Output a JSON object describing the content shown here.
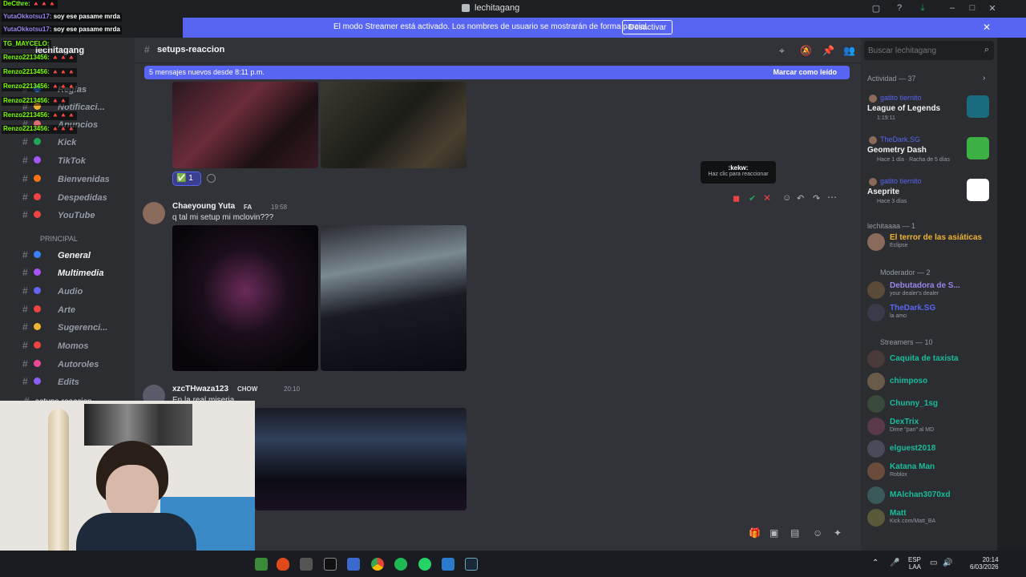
{
  "window": {
    "title": "lechitagang"
  },
  "banner": {
    "message": "El modo Streamer está activado. Los nombres de usuario se mostrarán de forma parcial.",
    "button": "Desactivar"
  },
  "stream_chat": [
    {
      "user": "DeCthre:",
      "text": "🔺🔺🔺"
    },
    {
      "user": "YutaOkkotsu17:",
      "text": "soy ese pasame mrda"
    },
    {
      "user": "YutaOkkotsu17:",
      "text": "soy ese pasame mrda"
    },
    {
      "user": "TG_MAYCELO:",
      "text": ""
    },
    {
      "user": "Renzo2213456:",
      "text": "🔺🔺🔺"
    },
    {
      "user": "Renzo2213456:",
      "text": "🔺🔺🔺"
    },
    {
      "user": "Renzo2213456:",
      "text": "🔺🔺🔺"
    },
    {
      "user": "Renzo2213456:",
      "text": "🔺🔺"
    },
    {
      "user": "Renzo2213456:",
      "text": "🔺🔺🔺"
    },
    {
      "user": "Renzo2213456:",
      "text": "🔺🔺🔺"
    }
  ],
  "sidebar": {
    "server_name": "lechitagang",
    "channels": [
      {
        "label": "Reglas"
      },
      {
        "label": "Notificaci..."
      },
      {
        "label": "Anuncios"
      },
      {
        "label": "Kick"
      },
      {
        "label": "TikTok"
      },
      {
        "label": "Bienvenidas"
      },
      {
        "label": "Despedidas"
      },
      {
        "label": "YouTube"
      }
    ],
    "category": "PRINCIPAL",
    "principal_channels": [
      {
        "label": "General"
      },
      {
        "label": "Multimedia"
      },
      {
        "label": "Audio"
      },
      {
        "label": "Arte"
      },
      {
        "label": "Sugerenci..."
      },
      {
        "label": "Momos"
      },
      {
        "label": "Autoroles"
      },
      {
        "label": "Edits"
      }
    ],
    "current_channel": "setups-reaccion"
  },
  "header": {
    "channel": "setups-reaccion"
  },
  "new_messages": {
    "label": "5 mensajes nuevos desde 8:11 p.m.",
    "action": "Marcar como leído"
  },
  "messages": [
    {
      "reaction_count": "1"
    },
    {
      "author": "Chaeyoung Yuta",
      "tag": "FA",
      "time": "19:58",
      "text": "q tal mi setup mi mclovin???"
    },
    {
      "author": "xzcTHwaza123",
      "tag": "CHOW",
      "time": "20:10",
      "text": "En la real miseria"
    }
  ],
  "tooltip": {
    "name": ":kekw:",
    "hint": "Haz clic para reaccionar"
  },
  "members": {
    "search_placeholder": "Buscar lechitagang",
    "activity_header": "Actividad — 37",
    "activities": [
      {
        "user": "gatito tiernito",
        "title": "League of Legends",
        "sub": "1:19:11",
        "color": "#1a6b7e"
      },
      {
        "user": "TheDark.SG",
        "title": "Geometry Dash",
        "sub": "Hace 1 día · Racha de 5 días",
        "color": "#3cb043"
      },
      {
        "user": "gatito tiernito",
        "title": "Aseprite",
        "sub": "Hace 3 días",
        "color": "#ffffff"
      }
    ],
    "groups": [
      {
        "header": "lechitaaaa — 1",
        "members": [
          {
            "name": "El terror de las asiáticas",
            "sub": "Eclipse",
            "color": "#f0b232"
          }
        ]
      },
      {
        "header": "Moderador — 2",
        "members": [
          {
            "name": "Debutadora de S...",
            "sub": "your dealer's dealer",
            "color": "#9b84ec"
          },
          {
            "name": "TheDark.SG",
            "sub": "la amo",
            "color": "#5865f2"
          }
        ]
      },
      {
        "header": "Streamers — 10",
        "members": [
          {
            "name": "Caquita de taxista",
            "sub": "",
            "color": "#1abc9c"
          },
          {
            "name": "chimposo",
            "sub": "",
            "color": "#1abc9c"
          },
          {
            "name": "Chunny_1sg",
            "sub": "",
            "color": "#1abc9c"
          },
          {
            "name": "DexTrix",
            "sub": "Dime \"pan\" al MD",
            "color": "#1abc9c"
          },
          {
            "name": "elguest2018",
            "sub": "",
            "color": "#1abc9c"
          },
          {
            "name": "Katana Man",
            "sub": "Roblox",
            "color": "#1abc9c"
          },
          {
            "name": "MAlchan3070xd",
            "sub": "",
            "color": "#1abc9c"
          },
          {
            "name": "Matt",
            "sub": "Kick.com/Matt_BA",
            "color": "#1abc9c"
          }
        ]
      }
    ]
  },
  "taskbar": {
    "lang": "ESP",
    "lang2": "LAA",
    "time": "20:14",
    "date": "6/03/2026"
  }
}
